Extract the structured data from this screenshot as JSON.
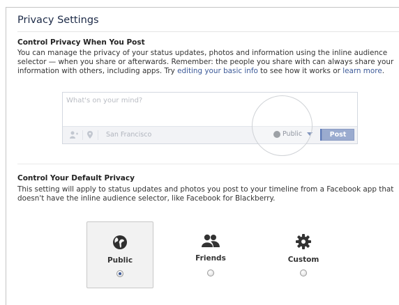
{
  "page_title": "Privacy Settings",
  "section1": {
    "heading": "Control Privacy When You Post",
    "text_before_link1": "You can manage the privacy of your status updates, photos and information using the inline audience selector — when you share or afterwards. Remember: the people you share with can always share your information with others, including apps. Try ",
    "link1": "editing your basic info",
    "text_between_links": " to see how it works or ",
    "link2": "learn more",
    "text_end": "."
  },
  "composer": {
    "placeholder": "What's on your mind?",
    "location": "San Francisco",
    "audience": "Public",
    "post_label": "Post",
    "icons": [
      "add-friend-icon",
      "location-pin-icon",
      "globe-icon",
      "dropdown-caret-icon"
    ]
  },
  "section2": {
    "heading": "Control Your Default Privacy",
    "text": "This setting will apply to status updates and photos you post to your timeline from a Facebook app that doesn't have the inline audience selector, like Facebook for Blackberry."
  },
  "options": [
    {
      "label": "Public",
      "icon": "globe-icon",
      "selected": true
    },
    {
      "label": "Friends",
      "icon": "friends-icon",
      "selected": false
    },
    {
      "label": "Custom",
      "icon": "gear-icon",
      "selected": false
    }
  ],
  "colors": {
    "link": "#3b5998",
    "post_button": "#9aabcf",
    "title": "#1c2a47"
  }
}
